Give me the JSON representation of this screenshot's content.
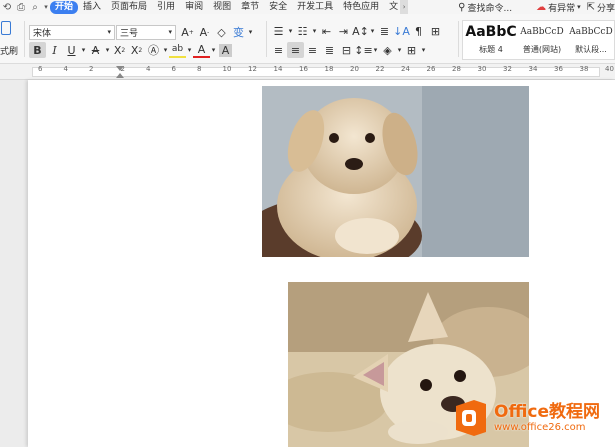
{
  "menubar": {
    "tabs": [
      "开始",
      "插入",
      "页面布局",
      "引用",
      "审阅",
      "视图",
      "章节",
      "安全",
      "开发工具",
      "特色应用",
      "文"
    ],
    "active_tab": "开始",
    "search_label": "查找命令...",
    "status_label": "有异常",
    "share_label": "分享"
  },
  "toolbar": {
    "format_painter_label": "式刷",
    "font_name": "宋体",
    "font_size": "三号",
    "styles": [
      {
        "preview": "AaBbC",
        "name": "标题 4"
      },
      {
        "preview": "AaBbCcD",
        "name": "普通(网站)"
      },
      {
        "preview": "AaBbCcD",
        "name": "默认段..."
      }
    ]
  },
  "ruler": {
    "numbers": [
      "6",
      "4",
      "2",
      "2",
      "4",
      "6",
      "8",
      "10",
      "12",
      "14",
      "16",
      "18",
      "20",
      "22",
      "24",
      "26",
      "28",
      "30",
      "32",
      "34",
      "36",
      "38",
      "40"
    ]
  },
  "watermark": {
    "brand": "Office教程网",
    "url": "www.office26.com"
  },
  "colors": {
    "accent": "#3c7ff0",
    "watermark_orange": "#f06a0f"
  }
}
